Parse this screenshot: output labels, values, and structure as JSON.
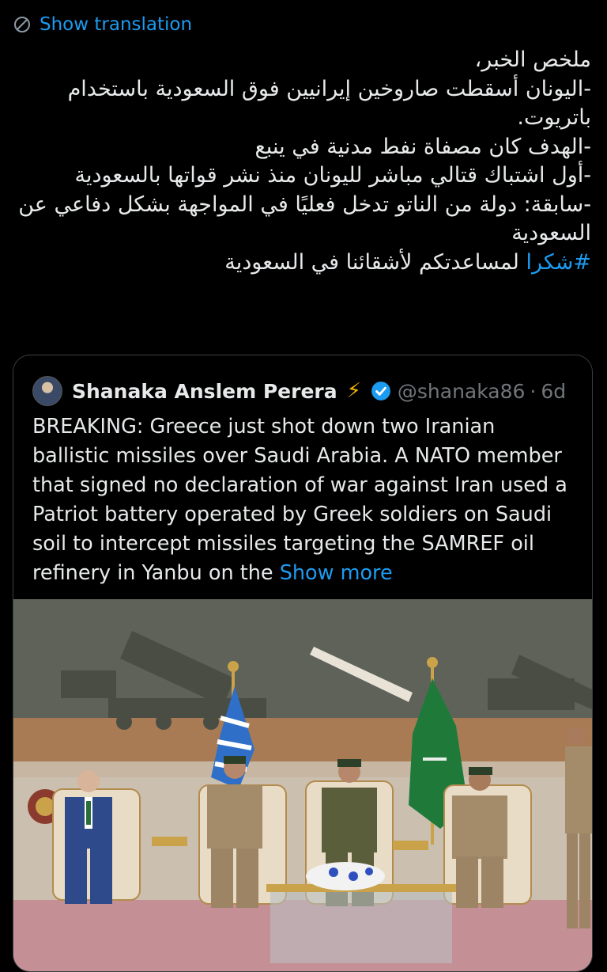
{
  "translation": {
    "label": "Show translation",
    "icon": "translate-globe-icon"
  },
  "post": {
    "lines": [
      "ملخص الخبر،",
      "-اليونان أسقطت صاروخين إيرانيين فوق السعودية باستخدام باتريوت.",
      "-الهدف كان مصفاة نفط مدنية في ينبع",
      "-أول اشتباك قتالي مباشر لليونان منذ نشر قواتها بالسعودية",
      "-سابقة: دولة من الناتو تدخل فعليًا في المواجهة بشكل دفاعي عن السعودية"
    ],
    "hashtag": "#شكرا",
    "hashtag_rest": " لمساعدتكم لأشقائنا في السعودية"
  },
  "quote": {
    "author_name": "Shanaka Anslem Perera",
    "handle": "@shanaka86",
    "separator": "·",
    "time": "6d",
    "text": "BREAKING: Greece just shot down two Iranian ballistic missiles over Saudi Arabia. A NATO member that signed no declaration of war against Iran used a Patriot battery operated by Greek soldiers on Saudi soil to intercept missiles targeting the SAMREF oil refinery in Yanbu on the",
    "show_more": "Show more",
    "icons": {
      "badge": "lightning-icon",
      "verified": "verified-badge-icon"
    },
    "colors": {
      "accent": "#1d9bf0",
      "verified": "#1d9bf0",
      "bolt": "#f5b400"
    }
  }
}
